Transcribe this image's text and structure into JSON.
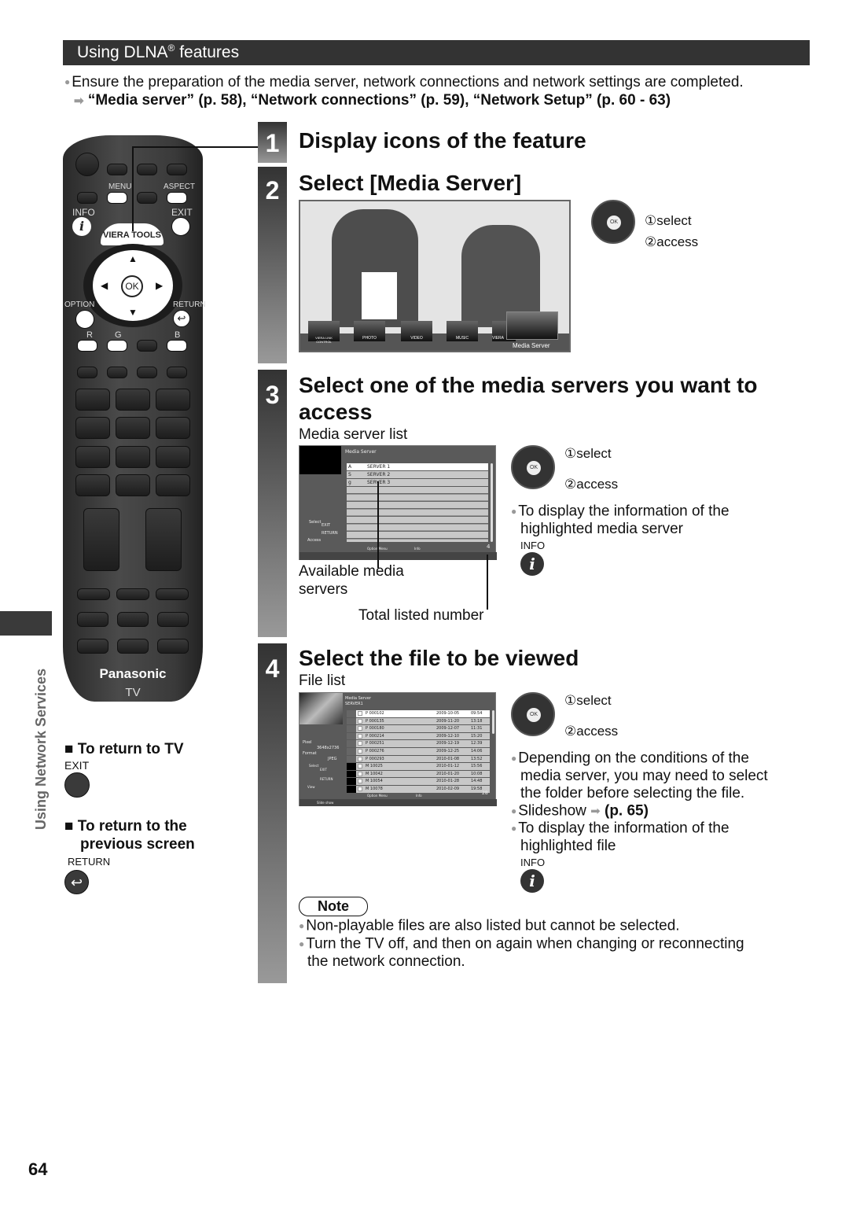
{
  "header": {
    "title": "Using DLNA",
    "reg": "®",
    "title_suffix": " features"
  },
  "intro": {
    "bullet": "Ensure the preparation of the media server, network connections and network settings are completed.",
    "refs": "“Media server” (p. 58), “Network connections” (p. 59), “Network Setup” (p. 60 - 63)"
  },
  "sidebar": {
    "section_label": "Using Network Services"
  },
  "remote": {
    "labels": {
      "menu": "MENU",
      "aspect": "ASPECT",
      "info": "INFO",
      "exit": "EXIT",
      "viera_tools": "VIERA TOOLS",
      "ok": "OK",
      "option": "OPTION",
      "return": "RETURN",
      "r": "R",
      "g": "G",
      "b": "B"
    },
    "brand": "Panasonic",
    "model": "TV"
  },
  "return_tv": {
    "title": "To return to TV",
    "button_label": "EXIT"
  },
  "return_prev": {
    "title": "To return to the",
    "title2": "previous screen",
    "button_label": "RETURN"
  },
  "steps": [
    {
      "num": "1",
      "title": "Display icons of the feature"
    },
    {
      "num": "2",
      "title": "Select [Media Server]",
      "menu_icons": [
        "VIERA LINK CONTROL",
        "PHOTO",
        "VIDEO",
        "MUSIC",
        "VIERA"
      ],
      "selected_icon": "Media Server",
      "nav": {
        "select": "select",
        "access": "access",
        "n1": "①",
        "n2": "②"
      }
    },
    {
      "num": "3",
      "title": "Select one of the media servers you want to",
      "title2": "access",
      "subtitle": "Media server list",
      "screen": {
        "title": "Media Server",
        "servers": [
          {
            "tag": "A",
            "name": "SERVER 1"
          },
          {
            "tag": "S",
            "name": "SERVER 2"
          },
          {
            "tag": "g",
            "name": "SERVER 3"
          }
        ],
        "help": {
          "select": "Select",
          "exit": "EXIT",
          "return": "RETURN",
          "access": "Access"
        },
        "footer": {
          "option": "Option Menu",
          "info": "Info"
        },
        "total": "4"
      },
      "callouts": {
        "available": "Available media",
        "available2": "servers",
        "total": "Total listed number"
      },
      "nav": {
        "select": "select",
        "access": "access",
        "n1": "①",
        "n2": "②"
      },
      "info_note": "To display the information of the",
      "info_note2": "highlighted media server",
      "info_label": "INFO"
    },
    {
      "num": "4",
      "title": "Select the file to be viewed",
      "subtitle": "File list",
      "screen": {
        "title": "Media Server",
        "folder": "SERVER1",
        "pixel_label": "Pixel",
        "pixel_value": "3648x2736",
        "format_label": "Format",
        "format_value": "JPEG",
        "help": {
          "select": "Select",
          "exit": "EXIT",
          "return": "RETURN",
          "view": "View"
        },
        "files": [
          {
            "name": "P 000102",
            "date": "2009-10-05",
            "time": "09:54"
          },
          {
            "name": "P 000135",
            "date": "2009-11-20",
            "time": "13:18"
          },
          {
            "name": "P 000180",
            "date": "2009-12-07",
            "time": "11:31"
          },
          {
            "name": "P 000214",
            "date": "2009-12-10",
            "time": "15:20"
          },
          {
            "name": "P 000251",
            "date": "2009-12-19",
            "time": "12:39"
          },
          {
            "name": "P 000276",
            "date": "2009-12-25",
            "time": "14:06"
          },
          {
            "name": "P 000293",
            "date": "2010-01-08",
            "time": "13:52"
          },
          {
            "name": "M 10025",
            "date": "2010-01-12",
            "time": "15:56"
          },
          {
            "name": "M 10042",
            "date": "2010-01-20",
            "time": "10:08"
          },
          {
            "name": "M 10054",
            "date": "2010-01-28",
            "time": "14:48"
          },
          {
            "name": "M 10078",
            "date": "2010-02-09",
            "time": "19:58"
          }
        ],
        "footer": {
          "option": "Option Menu",
          "info": "Info",
          "slideshow": "Slide show"
        },
        "total": "28"
      },
      "nav": {
        "select": "select",
        "access": "access",
        "n1": "①",
        "n2": "②"
      },
      "notes": [
        "Depending on the conditions of the",
        "media server, you may need to select",
        "the folder before selecting the file."
      ],
      "slideshow": "Slideshow",
      "slideshow_ref": "(p. 65)",
      "info_note": "To display the information of the",
      "info_note2": "highlighted file",
      "info_label": "INFO"
    }
  ],
  "note": {
    "label": "Note",
    "items": [
      "Non-playable files are also listed but cannot be selected.",
      "Turn the TV off, and then on again when changing or reconnecting",
      "the network connection."
    ]
  },
  "page_number": "64"
}
